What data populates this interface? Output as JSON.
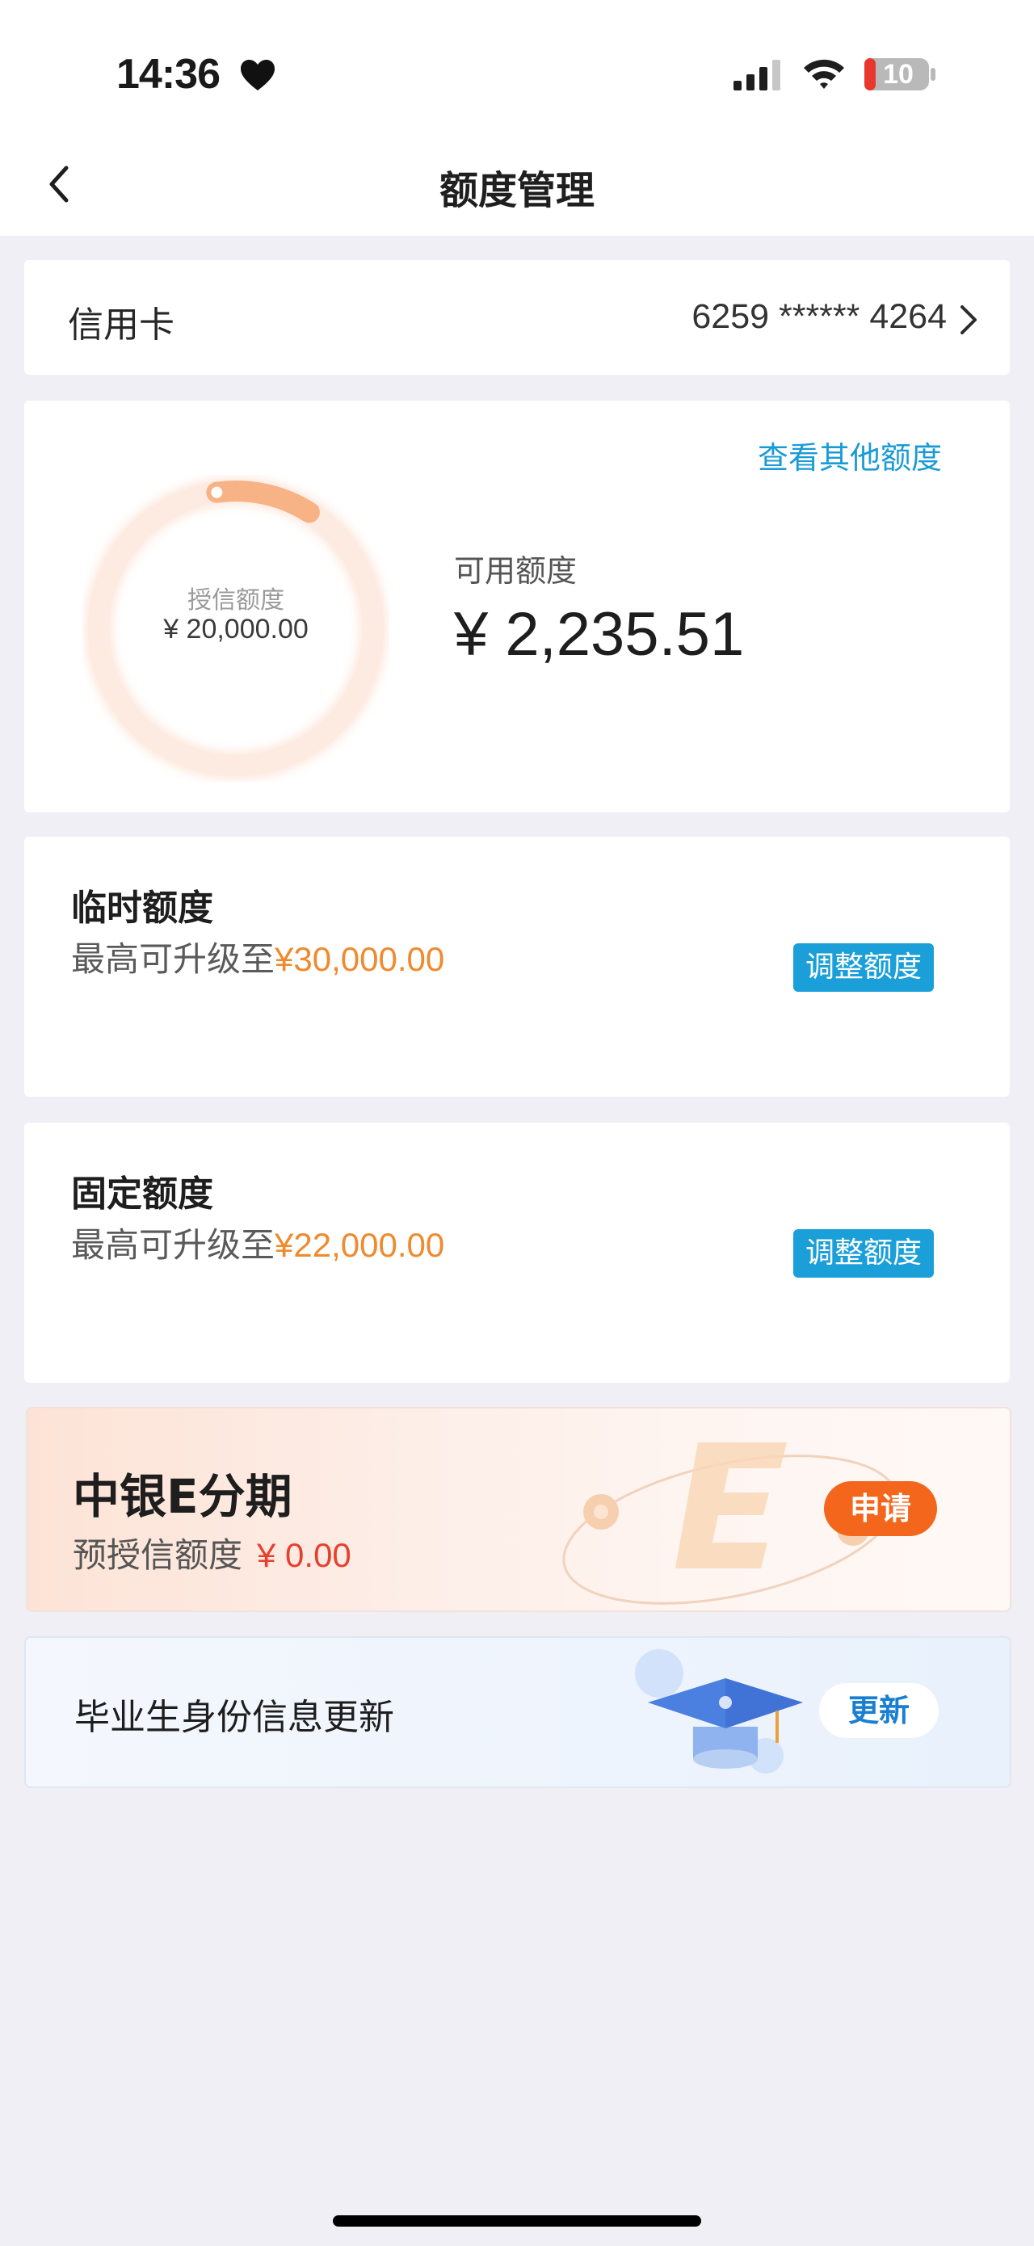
{
  "status_bar": {
    "time": "14:36",
    "battery": "10",
    "icons": [
      "heart-icon",
      "signal-icon",
      "wifi-icon",
      "battery-icon"
    ]
  },
  "header": {
    "title": "额度管理",
    "back_icon": "chevron-left-icon"
  },
  "card_row": {
    "type": "信用卡",
    "number": "6259 ****** 4264"
  },
  "limit": {
    "view_other": "查看其他额度",
    "credit_caption": "授信额度",
    "credit_value": "¥ 20,000.00",
    "available_label": "可用额度",
    "available_value": "¥ 2,235.51",
    "available_ratio": 0.112
  },
  "temp_limit": {
    "title": "临时额度",
    "desc_prefix": "最高可升级至",
    "amount": "¥30,000.00",
    "button": "调整额度"
  },
  "fixed_limit": {
    "title": "固定额度",
    "desc_prefix": "最高可升级至",
    "amount": "¥22,000.00",
    "button": "调整额度"
  },
  "promo": {
    "title": "中银E分期",
    "sub_label": "预授信额度",
    "amount": "¥ 0.00",
    "button": "申请"
  },
  "graduate": {
    "title": "毕业生身份信息更新",
    "button": "更新"
  },
  "colors": {
    "accent_blue": "#1a9fd8",
    "accent_orange": "#ef8a2e",
    "apply_orange": "#f3661c",
    "promo_red": "#e8402e"
  }
}
